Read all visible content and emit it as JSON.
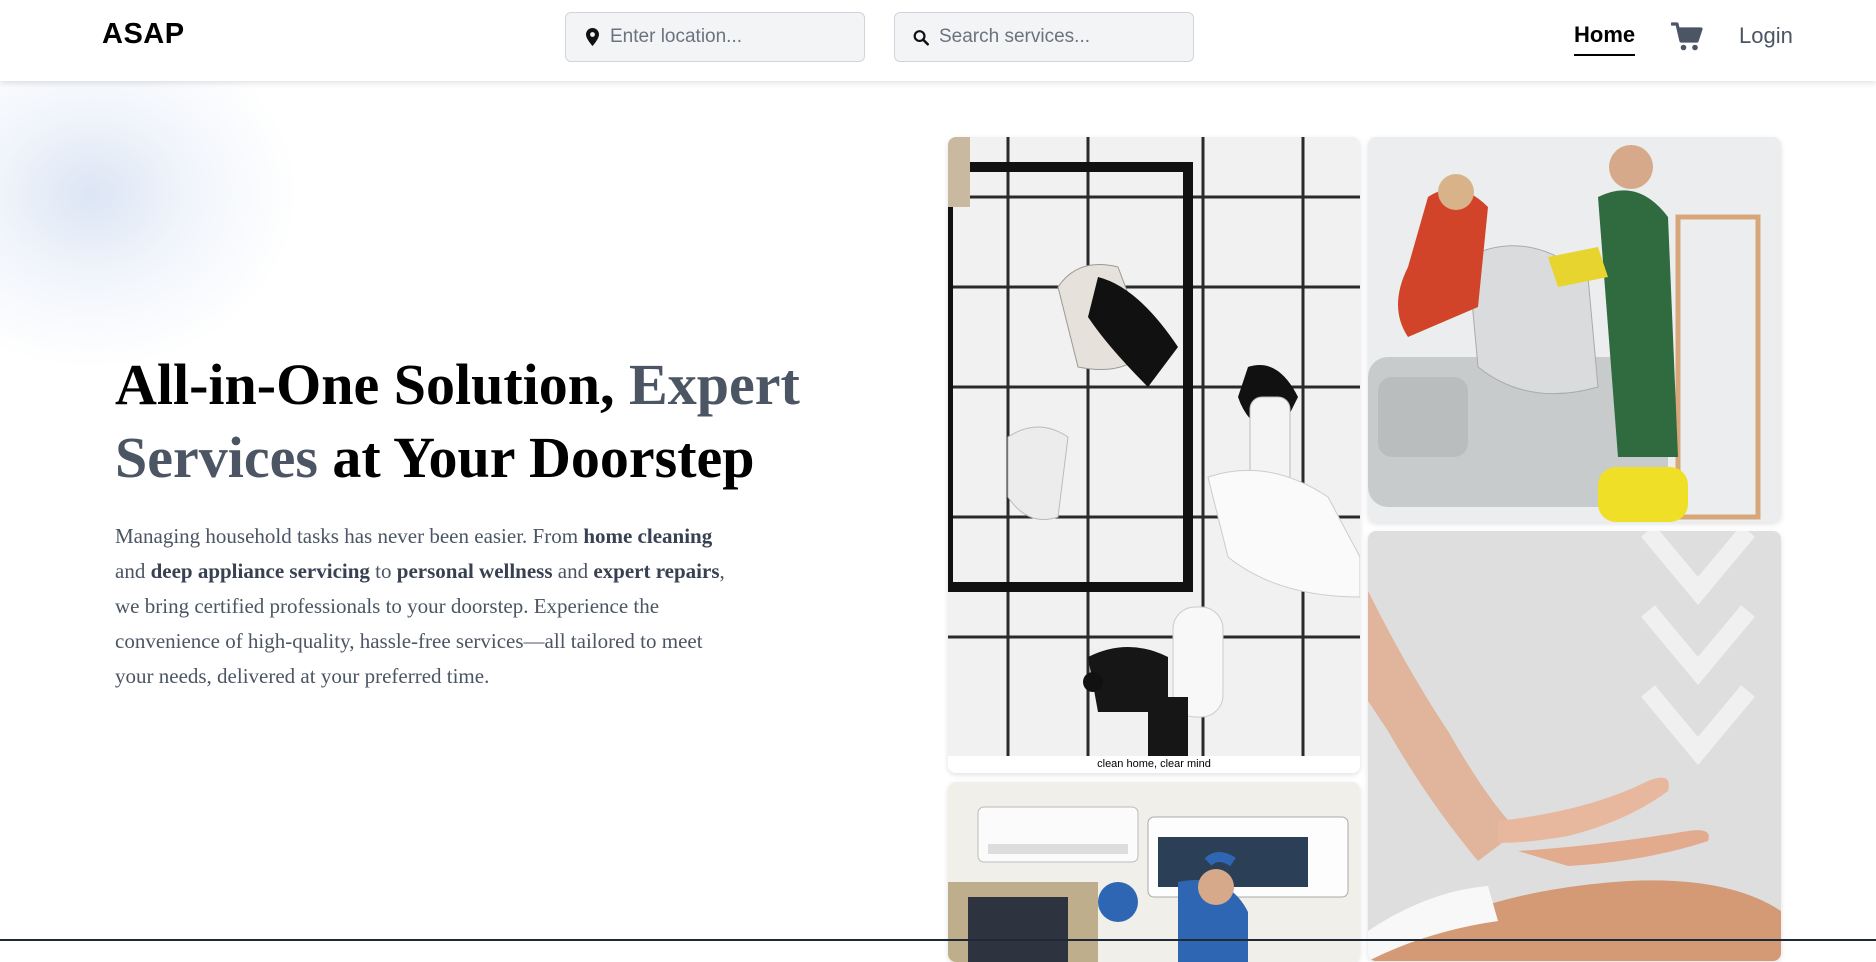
{
  "navbar": {
    "logo": "ASAP",
    "location_placeholder": "Enter location...",
    "search_placeholder": "Search services...",
    "home_label": "Home",
    "login_label": "Login",
    "icons": [
      "location-pin-icon",
      "search-icon",
      "cart-icon"
    ]
  },
  "hero": {
    "title_part1": "All-in-One Solution, ",
    "title_accent": "Expert Services",
    "title_part2": " at Your Doorstep",
    "desc": {
      "t1": "Managing household tasks has never been easier. From ",
      "b1": "home cleaning",
      "t2": " and ",
      "b2": "deep appliance servicing",
      "t3": " to ",
      "b3": "personal wellness",
      "t4": " and ",
      "b4": "expert repairs",
      "t5": ", we bring certified professionals to your doorstep. Experience the convenience of high-quality, hassle-free services—all tailored to meet your needs, delivered at your preferred time."
    }
  },
  "gallery": {
    "caption_1": "clean home, clear mind"
  },
  "colors": {
    "accent_text": "#4b5563",
    "input_bg": "#f3f4f6",
    "cart_icon": "#4b5563"
  }
}
